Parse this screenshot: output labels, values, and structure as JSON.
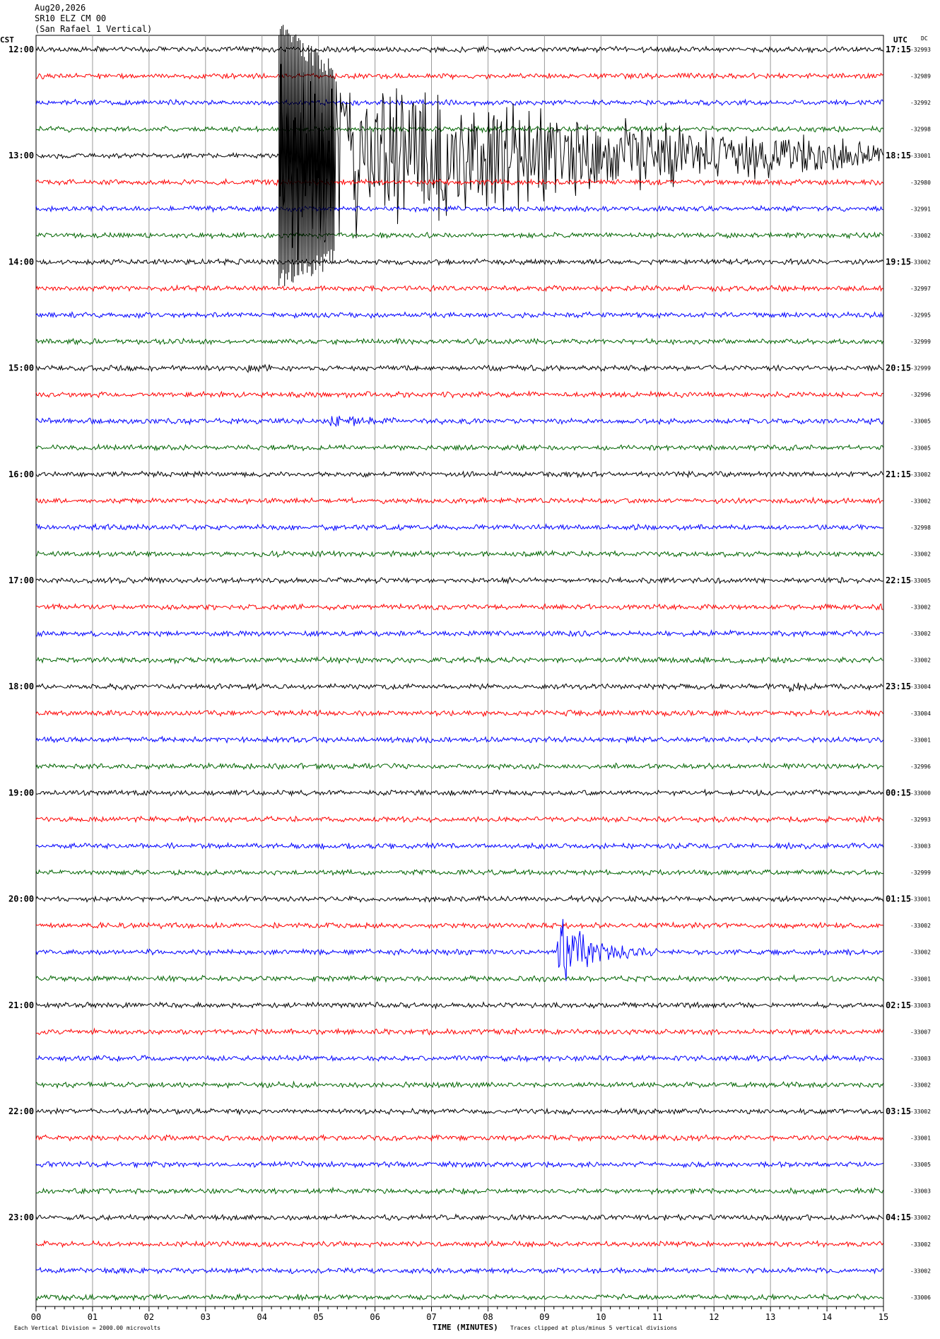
{
  "header": {
    "date": "Aug20,2026",
    "station": "SR10 ELZ CM 00",
    "location": "(San Rafael 1 Vertical)"
  },
  "chart_data": {
    "type": "line",
    "title": "",
    "left_axis_label": "CST",
    "right_axis_label": "UTC",
    "dc_label": "DC",
    "xlabel": "TIME (MINUTES)",
    "xlim": [
      0,
      15
    ],
    "x_ticks": [
      "00",
      "01",
      "02",
      "03",
      "04",
      "05",
      "06",
      "07",
      "08",
      "09",
      "10",
      "11",
      "12",
      "13",
      "14",
      "15"
    ],
    "trace_colors": [
      "#000000",
      "#ff0000",
      "#0000ff",
      "#006400"
    ],
    "grid": true,
    "hours": [
      {
        "cst": "12:00",
        "utc": "17:15",
        "dc": [
          "-32993",
          "-32989",
          "-32992",
          "-32998"
        ]
      },
      {
        "cst": "13:00",
        "utc": "18:15",
        "dc": [
          "-33001",
          "-32980",
          "-32991",
          "-33002"
        ]
      },
      {
        "cst": "14:00",
        "utc": "19:15",
        "dc": [
          "-33002",
          "-32997",
          "-32995",
          "-32999"
        ]
      },
      {
        "cst": "15:00",
        "utc": "20:15",
        "dc": [
          "-32999",
          "-32996",
          "-33005",
          "-33005"
        ]
      },
      {
        "cst": "16:00",
        "utc": "21:15",
        "dc": [
          "-33002",
          "-33002",
          "-32998",
          "-33002"
        ]
      },
      {
        "cst": "17:00",
        "utc": "22:15",
        "dc": [
          "-33005",
          "-33002",
          "-33002",
          "-33002"
        ]
      },
      {
        "cst": "18:00",
        "utc": "23:15",
        "dc": [
          "-33004",
          "-33004",
          "-33001",
          "-32996"
        ]
      },
      {
        "cst": "19:00",
        "utc": "00:15",
        "dc": [
          "-33000",
          "-32993",
          "-33003",
          "-32999"
        ]
      },
      {
        "cst": "20:00",
        "utc": "01:15",
        "dc": [
          "-33001",
          "-33002",
          "-33002",
          "-33001"
        ]
      },
      {
        "cst": "21:00",
        "utc": "02:15",
        "dc": [
          "-33003",
          "-33007",
          "-33003",
          "-33002"
        ]
      },
      {
        "cst": "22:00",
        "utc": "03:15",
        "dc": [
          "-33002",
          "-33001",
          "-33005",
          "-33003"
        ]
      },
      {
        "cst": "23:00",
        "utc": "04:15",
        "dc": [
          "-33002",
          "-33002",
          "-33002",
          "-33006"
        ]
      }
    ],
    "events": [
      {
        "trace": 4,
        "start_min": 4.3,
        "end_min": 15.0,
        "amplitude": 5,
        "type": "large_quake"
      },
      {
        "trace": 14,
        "start_min": 5.2,
        "end_min": 6.5,
        "amplitude": 0.4,
        "type": "burst"
      },
      {
        "trace": 34,
        "start_min": 9.2,
        "end_min": 11.0,
        "amplitude": 1.8,
        "type": "local_quake"
      },
      {
        "trace": 24,
        "start_min": 13.3,
        "end_min": 14.3,
        "amplitude": 0.25,
        "type": "burst"
      },
      {
        "trace": 12,
        "start_min": 3.7,
        "end_min": 4.5,
        "amplitude": 0.25,
        "type": "burst"
      }
    ],
    "footer_left": "Each Vertical Division = 2000.00 microvolts",
    "footer_right": "Traces clipped at plus/minus 5 vertical divisions"
  }
}
